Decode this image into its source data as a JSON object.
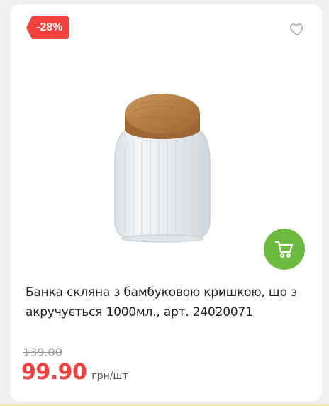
{
  "product": {
    "discount": "-28%",
    "title": "Банка скляна з бамбуковою кришкою, що з акручується 1000мл., арт. 24020071",
    "old_price": "139.00",
    "price": "99.90",
    "unit": "грн/шт",
    "image_alt": "glass-jar-with-wooden-lid"
  },
  "icons": {
    "wishlist": "heart-outline-icon",
    "cart": "cart-icon"
  },
  "colors": {
    "badge": "#f1413d",
    "price": "#f1413d",
    "cart_button": "#6cbb3f",
    "background": "#f0f0f1"
  }
}
